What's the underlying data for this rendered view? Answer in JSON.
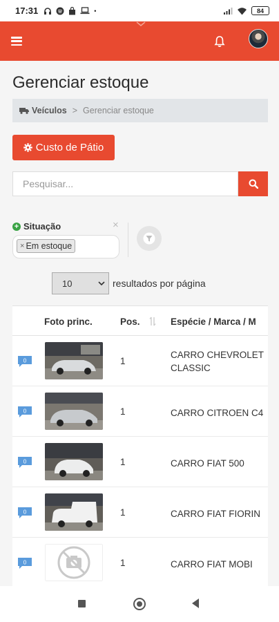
{
  "status_bar": {
    "time": "17:31",
    "battery": "84"
  },
  "appbar": {
    "bg_color": "#e84a30"
  },
  "page": {
    "title": "Gerenciar estoque"
  },
  "breadcrumb": {
    "home": "Veículos",
    "separator": ">",
    "current": "Gerenciar estoque"
  },
  "actions": {
    "custo_label": "Custo de Pátio"
  },
  "search": {
    "placeholder": "Pesquisar..."
  },
  "filter": {
    "label": "Situação",
    "clear": "×",
    "chip_x": "×",
    "chip_label": "Em estoque"
  },
  "pagination": {
    "page_size": "10",
    "label": "resultados por página"
  },
  "table": {
    "headers": {
      "foto": "Foto princ.",
      "pos": "Pos.",
      "especie": "Espécie / Marca / M"
    },
    "rows": [
      {
        "count": "0",
        "pos": "1",
        "especie_line1": "CARRO CHEVROLET",
        "especie_line2": "CLASSIC",
        "photo": "silver-sedan"
      },
      {
        "count": "0",
        "pos": "1",
        "especie_line1": "CARRO CITROEN C4",
        "photo": "silver-hatch"
      },
      {
        "count": "0",
        "pos": "1",
        "especie_line1": "CARRO FIAT 500",
        "photo": "white-500"
      },
      {
        "count": "0",
        "pos": "1",
        "especie_line1": "CARRO FIAT FIORIN",
        "photo": "white-van"
      },
      {
        "count": "0",
        "pos": "1",
        "especie_line1": "CARRO FIAT MOBI",
        "photo": "no-photo-icon"
      }
    ]
  }
}
